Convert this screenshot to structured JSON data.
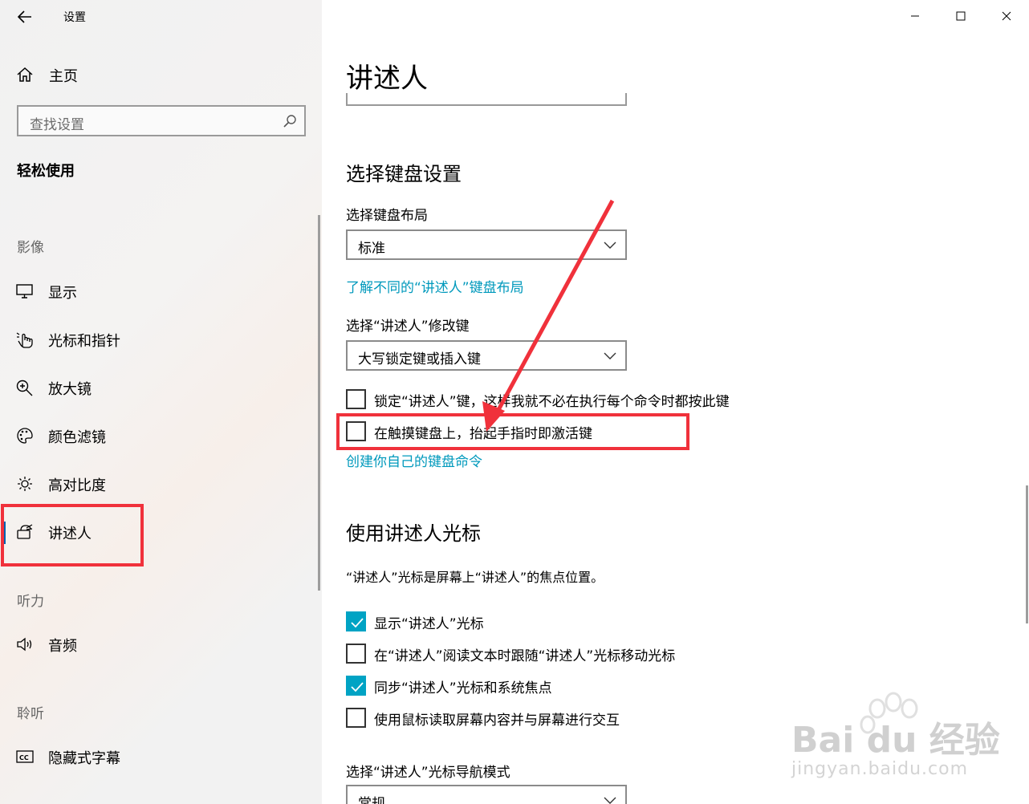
{
  "window": {
    "title": "设置",
    "controls": [
      "minimize",
      "maximize",
      "close"
    ]
  },
  "sidebar": {
    "home_label": "主页",
    "search_placeholder": "查找设置",
    "section_title": "轻松使用",
    "groups": [
      {
        "label": "影像"
      },
      {
        "label": "听力"
      },
      {
        "label": "聆听"
      }
    ],
    "items": [
      {
        "label": "显示",
        "icon": "monitor-icon"
      },
      {
        "label": "光标和指针",
        "icon": "pointer-icon"
      },
      {
        "label": "放大镜",
        "icon": "magnifier-icon"
      },
      {
        "label": "颜色滤镜",
        "icon": "palette-icon"
      },
      {
        "label": "高对比度",
        "icon": "brightness-icon"
      },
      {
        "label": "讲述人",
        "icon": "narrator-icon",
        "selected": true
      },
      {
        "label": "音频",
        "icon": "speaker-icon"
      },
      {
        "label": "隐藏式字幕",
        "icon": "captions-icon"
      }
    ]
  },
  "main": {
    "page_title": "讲述人",
    "keyboard_section": {
      "heading": "选择键盘设置",
      "layout_label": "选择键盘布局",
      "layout_value": "标准",
      "layout_link": "了解不同的“讲述人”键盘布局",
      "modifier_label": "选择“讲述人”修改键",
      "modifier_value": "大写锁定键或插入键",
      "checkboxes": [
        {
          "label": "锁定“讲述人”键，这样我就不必在执行每个命令时都按此键",
          "checked": false
        },
        {
          "label": "在触摸键盘上，抬起手指时即激活键",
          "checked": false
        }
      ],
      "commands_link": "创建你自己的键盘命令"
    },
    "cursor_section": {
      "heading": "使用讲述人光标",
      "description": "“讲述人”光标是屏幕上“讲述人”的焦点位置。",
      "checkboxes": [
        {
          "label": "显示“讲述人”光标",
          "checked": true
        },
        {
          "label": "在“讲述人”阅读文本时跟随“讲述人”光标移动光标",
          "checked": false
        },
        {
          "label": "同步“讲述人”光标和系统焦点",
          "checked": true
        },
        {
          "label": "使用鼠标读取屏幕内容并与屏幕进行交互",
          "checked": false
        }
      ],
      "nav_mode_label": "选择“讲述人”光标导航模式",
      "nav_mode_value": "常规"
    }
  },
  "watermark": {
    "brand": "Bai du 经验",
    "site": "jingyan.baidu.com"
  },
  "colors": {
    "accent": "#00a3c4",
    "link": "#0099bc",
    "annotation": "#f0313b",
    "selected_bar": "#0063b1"
  }
}
